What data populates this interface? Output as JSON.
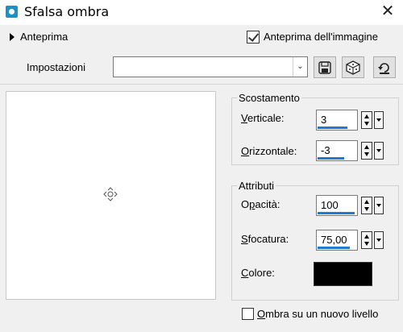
{
  "window": {
    "title": "Sfalsa ombra",
    "close_glyph": "✕",
    "app_icon": "app-icon"
  },
  "header": {
    "anteprima_label": "Anteprima",
    "image_preview_checkbox": {
      "label": "Anteprima dell'immagine",
      "checked": true
    }
  },
  "presets": {
    "label": "Impostazioni",
    "value": "",
    "buttons": [
      "save-preset-icon",
      "randomize-dice-icon",
      "reset-icon"
    ]
  },
  "scostamento": {
    "title": "Scostamento",
    "verticale": {
      "label": "Verticale:",
      "value": "3",
      "fill": 0.8
    },
    "orizzontale": {
      "label": "Orizzontale:",
      "value": "-3",
      "fill": 0.72
    }
  },
  "attributi": {
    "title": "Attributi",
    "opacita": {
      "label": "Opacità:",
      "value": "100",
      "fill": 1.0
    },
    "sfocatura": {
      "label": "Sfocatura:",
      "value": "75,00",
      "fill": 0.88
    },
    "colore": {
      "label": "Colore:",
      "swatch": "#000000"
    }
  },
  "footer": {
    "new_layer_checkbox": {
      "label": "Ombra su un nuovo livello",
      "checked": false
    }
  }
}
